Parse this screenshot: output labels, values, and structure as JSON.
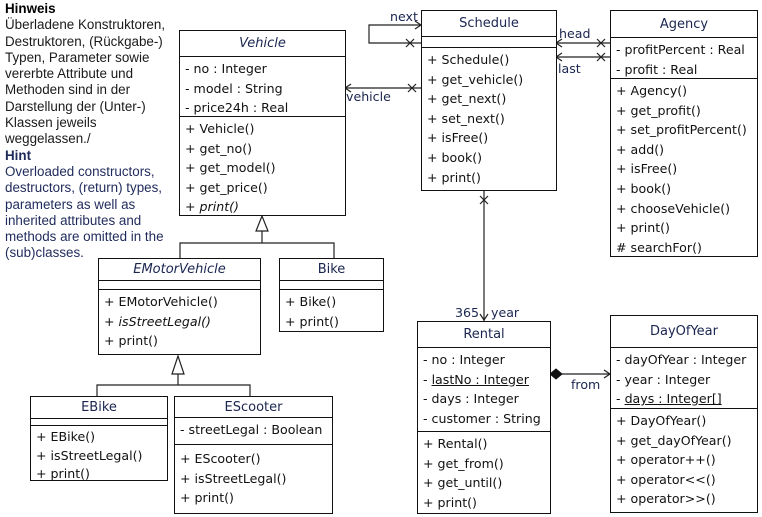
{
  "hint": {
    "de_title": "Hinweis",
    "de_text": "Überladene Konstruktoren, Destruktoren, (Rückgabe-) Typen, Parameter sowie vererbte Attribute und Methoden sind in der Darstellung der (Unter-) Klassen jeweils weggelassen./",
    "en_title": "Hint",
    "en_text": "Overloaded constructors, destructors, (return) types, parameters as well as inherited attributes and methods are omitted in the (sub)classes."
  },
  "classes": {
    "vehicle": {
      "name": "Vehicle",
      "abstract": true,
      "attributes": [
        "- no : Integer",
        "- model : String",
        "- price24h : Real"
      ],
      "methods": [
        "+ Vehicle()",
        "+ get_no()",
        "+ get_model()",
        "+ get_price()",
        "+ print()"
      ]
    },
    "schedule": {
      "name": "Schedule",
      "abstract": false,
      "attributes": [],
      "methods": [
        "+ Schedule()",
        "+ get_vehicle()",
        "+ get_next()",
        "+ set_next()",
        "+ isFree()",
        "+ book()",
        "+ print()"
      ]
    },
    "agency": {
      "name": "Agency",
      "abstract": false,
      "attributes": [
        "- profitPercent : Real",
        "- profit : Real"
      ],
      "methods": [
        "+ Agency()",
        "+ get_profit()",
        "+ set_profitPercent()",
        "+ add()",
        "+ isFree()",
        "+ book()",
        "+ chooseVehicle()",
        "+ print()",
        "# searchFor()"
      ]
    },
    "emotorvehicle": {
      "name": "EMotorVehicle",
      "abstract": true,
      "attributes": [],
      "methods": [
        "+ EMotorVehicle()",
        "+ isStreetLegal()",
        "+ print()"
      ]
    },
    "bike": {
      "name": "Bike",
      "abstract": false,
      "attributes": [],
      "methods": [
        "+ Bike()",
        "+ print()"
      ]
    },
    "ebike": {
      "name": "EBike",
      "abstract": false,
      "attributes": [],
      "methods": [
        "+ EBike()",
        "+ isStreetLegal()",
        "+ print()"
      ]
    },
    "escooter": {
      "name": "EScooter",
      "abstract": false,
      "attributes": [
        "- streetLegal : Boolean"
      ],
      "methods": [
        "+ EScooter()",
        "+ isStreetLegal()",
        "+ print()"
      ]
    },
    "rental": {
      "name": "Rental",
      "abstract": false,
      "attributes": [
        "- no : Integer",
        "- lastNo : Integer",
        "- days : Integer",
        "- customer : String"
      ],
      "methods": [
        "+ Rental()",
        "+ get_from()",
        "+ get_until()",
        "+ print()"
      ]
    },
    "dayofyear": {
      "name": "DayOfYear",
      "abstract": false,
      "attributes": [
        "- dayOfYear : Integer",
        "- year : Integer",
        "- days : Integer[]"
      ],
      "methods": [
        "+ DayOfYear()",
        "+ get_dayOfYear()",
        "+ operator++()",
        "+ operator<<()",
        "+ operator>>()"
      ]
    }
  },
  "associations": {
    "next": "next",
    "head": "head",
    "last": "last",
    "vehicle": "vehicle",
    "year_multiplicity": "365",
    "year": "year",
    "from": "from"
  }
}
